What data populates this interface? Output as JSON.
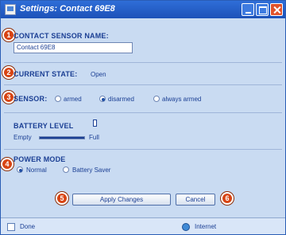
{
  "window": {
    "title": "Settings: Contact 69E8"
  },
  "form": {
    "contact_sensor_name_label": "CONTACT SENSOR NAME:",
    "contact_sensor_name_value": "Contact 69E8",
    "current_state_label": "CURRENT STATE:",
    "current_state_value": "Open",
    "sensor_label": "SENSOR:",
    "sensor_options": [
      "armed",
      "disarmed",
      "always armed"
    ],
    "sensor_selected": "disarmed",
    "battery_level_label": "BATTERY LEVEL",
    "battery_empty_label": "Empty",
    "battery_full_label": "Full",
    "battery_level_fraction": 1.0,
    "power_mode_label": "POWER MODE",
    "power_mode_options": [
      "Normal",
      "Battery Saver"
    ],
    "power_mode_selected": "Normal"
  },
  "buttons": {
    "apply_label": "Apply Changes",
    "cancel_label": "Cancel"
  },
  "callouts": [
    "1",
    "2",
    "3",
    "4",
    "5",
    "6"
  ],
  "statusbar": {
    "left_text": "Done",
    "right_text": "Internet"
  },
  "colors": {
    "title_bar": "#2f6ed8",
    "window_bg": "#c9dbf2",
    "label_text": "#1b3f94",
    "callout": "#d84413",
    "close_button": "#e0522b"
  },
  "icons": [
    "window-icon",
    "minimize-icon",
    "maximize-icon",
    "close-icon",
    "battery-icon",
    "page-icon",
    "globe-icon"
  ]
}
